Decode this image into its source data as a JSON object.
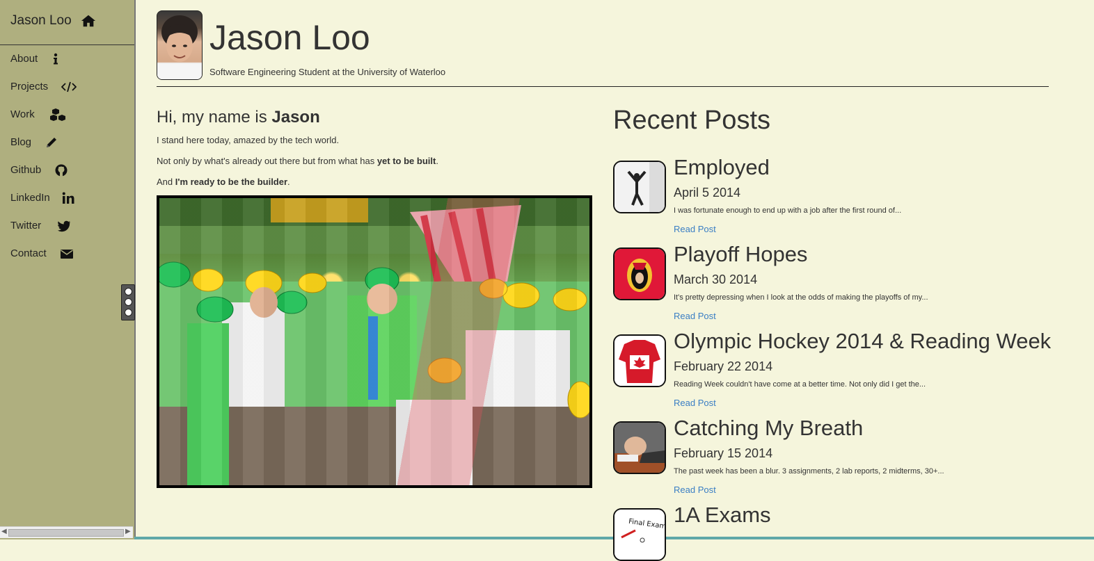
{
  "sidebar": {
    "brand": "Jason Loo",
    "items": [
      {
        "label": "About",
        "icon": "info-icon"
      },
      {
        "label": "Projects",
        "icon": "code-icon"
      },
      {
        "label": "Work",
        "icon": "cubes-icon"
      },
      {
        "label": "Blog",
        "icon": "pencil-icon"
      },
      {
        "label": "Github",
        "icon": "github-icon"
      },
      {
        "label": "LinkedIn",
        "icon": "linkedin-icon"
      },
      {
        "label": "Twitter",
        "icon": "twitter-icon"
      },
      {
        "label": "Contact",
        "icon": "envelope-icon"
      }
    ]
  },
  "header": {
    "title": "Jason Loo",
    "subtitle": "Software Engineering Student at the University of Waterloo"
  },
  "intro": {
    "greeting_prefix": "Hi, my name is ",
    "greeting_name": "Jason",
    "line1": "I stand here today, amazed by the tech world.",
    "line2_prefix": "Not only by what's already out there but from what has ",
    "line2_bold": "yet to be built",
    "line2_suffix": ".",
    "line3_prefix": "And ",
    "line3_bold": "I'm ready to be the builder",
    "line3_suffix": "."
  },
  "posts": {
    "heading": "Recent Posts",
    "read_label": "Read Post",
    "items": [
      {
        "title": "Employed",
        "date": "April 5 2014",
        "excerpt": "I was fortunate enough to end up with a job after the first round of..."
      },
      {
        "title": "Playoff Hopes",
        "date": "March 30 2014",
        "excerpt": "It's pretty depressing when I look at the odds of making the playoffs of my..."
      },
      {
        "title": "Olympic Hockey 2014 & Reading Week",
        "date": "February 22 2014",
        "excerpt": "Reading Week couldn't have come at a better time. Not only did I get the..."
      },
      {
        "title": "Catching My Breath",
        "date": "February 15 2014",
        "excerpt": "The past week has been a blur. 3 assignments, 2 lab reports, 2 midterms, 30+..."
      },
      {
        "title": "1A Exams",
        "date": "",
        "excerpt": "",
        "thumb_text": "Final Exam"
      }
    ]
  },
  "colors": {
    "sidebar_bg": "#afaf7f",
    "page_bg": "#f5f5dc",
    "link": "#3a7ec4"
  }
}
